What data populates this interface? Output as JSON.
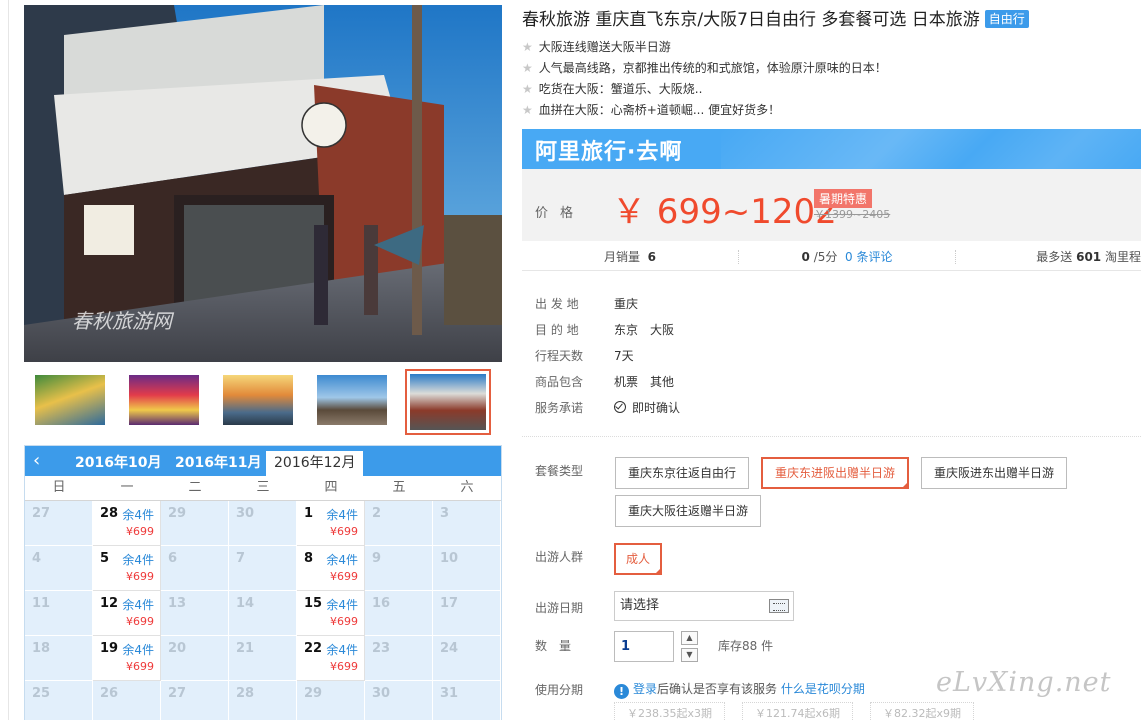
{
  "product": {
    "title": "春秋旅游 重庆直飞东京/大阪7日自由行 多套餐可选 日本旅游",
    "tag": "自由行",
    "features": [
      "大阪连线赠送大阪半日游",
      "人气最高线路，京都推出传统的和式旅馆，体验原汁原味的日本！",
      "吃货在大阪：蟹道乐、大阪烧..",
      "血拼在大阪：心斋桥+道顿崛... 便宜好货多！"
    ],
    "photo_watermark": "春秋旅游网"
  },
  "price_box": {
    "brand": "阿里旅行·去啊",
    "label": "价格",
    "price": "￥ 699~1202",
    "promo": "暑期特惠",
    "old_price": "￥1399~2405"
  },
  "stats": {
    "sales_label": "月销量",
    "sales_value": "6",
    "rating_value": "0",
    "rating_suffix": "/5分",
    "reviews_link": "0 条评论",
    "points_prefix": "最多送",
    "points_value": "601",
    "points_suffix": "淘里程"
  },
  "info": [
    {
      "key": "出 发 地",
      "value": "重庆"
    },
    {
      "key": "目 的 地",
      "value": "东京　大阪"
    },
    {
      "key": "行程天数",
      "value": "7天"
    },
    {
      "key": "商品包含",
      "value": "机票　其他"
    },
    {
      "key": "服务承诺",
      "value": "即时确认"
    }
  ],
  "options": {
    "package_label": "套餐类型",
    "packages": [
      "重庆东京往返自由行",
      "重庆东进阪出赠半日游",
      "重庆阪进东出赠半日游",
      "重庆大阪往返赠半日游"
    ],
    "selected_package_index": 1,
    "group_label": "出游人群",
    "group_value": "成人",
    "date_label": "出游日期",
    "date_placeholder": "请选择",
    "qty_label": "数　量",
    "qty_value": "1",
    "stock_text": "库存88 件",
    "installment_label": "使用分期",
    "installment_login": "登录",
    "installment_text": "后确认是否享有该服务",
    "installment_link": "什么是花呗分期",
    "periods": [
      "￥238.35起x3期",
      "￥121.74起x6期",
      "￥82.32起x9期"
    ]
  },
  "calendar": {
    "prev_icon": "‹",
    "months": [
      "2016年10月",
      "2016年11月",
      "2016年12月"
    ],
    "active_month_index": 2,
    "weekdays": [
      "日",
      "一",
      "二",
      "三",
      "四",
      "五",
      "六"
    ],
    "cells": [
      {
        "d": "27"
      },
      {
        "d": "28",
        "stock": "余4件",
        "price": "¥699"
      },
      {
        "d": "29"
      },
      {
        "d": "30"
      },
      {
        "d": "1",
        "stock": "余4件",
        "price": "¥699"
      },
      {
        "d": "2"
      },
      {
        "d": "3"
      },
      {
        "d": "4"
      },
      {
        "d": "5",
        "stock": "余4件",
        "price": "¥699"
      },
      {
        "d": "6"
      },
      {
        "d": "7"
      },
      {
        "d": "8",
        "stock": "余4件",
        "price": "¥699"
      },
      {
        "d": "9"
      },
      {
        "d": "10"
      },
      {
        "d": "11"
      },
      {
        "d": "12",
        "stock": "余4件",
        "price": "¥699"
      },
      {
        "d": "13"
      },
      {
        "d": "14"
      },
      {
        "d": "15",
        "stock": "余4件",
        "price": "¥699"
      },
      {
        "d": "16"
      },
      {
        "d": "17"
      },
      {
        "d": "18"
      },
      {
        "d": "19",
        "stock": "余4件",
        "price": "¥699"
      },
      {
        "d": "20"
      },
      {
        "d": "21"
      },
      {
        "d": "22",
        "stock": "余4件",
        "price": "¥699"
      },
      {
        "d": "23"
      },
      {
        "d": "24"
      },
      {
        "d": "25"
      },
      {
        "d": "26"
      },
      {
        "d": "27"
      },
      {
        "d": "28"
      },
      {
        "d": "29"
      },
      {
        "d": "30"
      },
      {
        "d": "31"
      }
    ]
  },
  "site_watermark": "eLvXing.net",
  "colors": {
    "accent": "#3c9bea",
    "price": "#f04a2d",
    "selected": "#e45e3f"
  }
}
